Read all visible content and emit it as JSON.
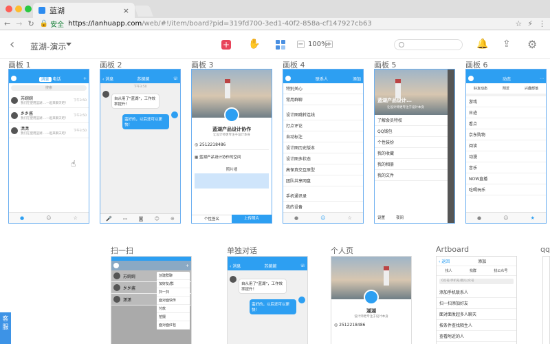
{
  "browser": {
    "tab_title": "蓝湖",
    "tab_close": "×",
    "url_host": "https://lanhuapp.com",
    "url_path": "/web/#!/item/board?pid=319fd700-3ed1-40f2-858a-cf147927cb63",
    "security_label": "安全",
    "traffic_colors": [
      "#fd5f57",
      "#febc2e",
      "#29c840"
    ]
  },
  "header": {
    "back": "‹",
    "project_name": "蓝湖-演示",
    "zoom": "100%",
    "zoom_minus": "−",
    "zoom_plus": "+",
    "add": "+"
  },
  "boards": [
    {
      "label": "画板 1"
    },
    {
      "label": "画板 2"
    },
    {
      "label": "画板 3"
    },
    {
      "label": "画板 4"
    },
    {
      "label": "画板 5"
    },
    {
      "label": "画板 6"
    }
  ],
  "boards_row2": [
    {
      "label": "扫一扫"
    },
    {
      "label": "单独对话"
    },
    {
      "label": "个人页"
    },
    {
      "label": "Artboard"
    },
    {
      "label": "qq"
    }
  ],
  "board1": {
    "tabs": [
      "消息",
      "电话"
    ],
    "search": "搜索",
    "rows": [
      {
        "name": "苏婉婉",
        "sub": "我们在使用蓝湖 ...一起来聊天吧！",
        "time": "下午3:50"
      },
      {
        "name": "乡乡酱",
        "sub": "我们在使用蓝湖 ...一起来聊天吧！",
        "time": "下午3:50"
      },
      {
        "name": "潇潇",
        "sub": "我们在使用蓝湖 ...一起来聊天吧！",
        "time": "下午3:50"
      }
    ]
  },
  "board2": {
    "title": "苏婉婉",
    "back": "‹ 消息",
    "time": "下午3:50",
    "msg_left": "自从用了\"蓝湖\"，工作效率提升！",
    "msg_right": "蛮好的，以后还可以更快！"
  },
  "board3": {
    "name": "蓝湖产品设计协作",
    "tag": "让设计师更专注于设计本身",
    "qq": "2512218486",
    "space": "蓝湖产品设计协作的空间",
    "wall": "照片墙",
    "btn_left": "个性签名",
    "btn_right": "上传照片"
  },
  "board4": {
    "title": "联系人",
    "add": "添加",
    "items": [
      "特别关心",
      "常用群聊",
      "设计图跳转连线",
      "打点评论",
      "自动标注",
      "设计图历史版本",
      "设计图多状态",
      "高保真交互原型",
      "团队共享网盘",
      "手机通讯录",
      "我的设备"
    ]
  },
  "board5": {
    "title": "蓝湖产品设计...",
    "sub": "让设计师更专注于设计本身",
    "items": [
      "了解会员特权",
      "QQ钱包",
      "个性装扮",
      "我的收藏",
      "我的相册",
      "我的文件"
    ],
    "footer_left": "设置",
    "footer_right": "夜间"
  },
  "board6": {
    "title": "动态",
    "top": [
      "好友动态",
      "附近",
      "兴趣部落"
    ],
    "items": [
      "游戏",
      "日迹",
      "看点",
      "京东购物",
      "阅读",
      "动漫",
      "音乐",
      "NOW直播",
      "吃喝玩乐"
    ]
  },
  "scan": {
    "menu": [
      "创建群聊",
      "加好友/群",
      "扫一扫",
      "面对面快传",
      "付款",
      "拍摄",
      "面对面红包"
    ],
    "rows": [
      "苏婉婉",
      "乡乡酱",
      "潇潇"
    ]
  },
  "chat2": {
    "title": "苏婉婉",
    "back": "‹ 消息",
    "msg_left": "自从用了\"蓝湖\"，工作效率提升！",
    "msg_right": "蛮好的，以后还可以更快！"
  },
  "profile": {
    "name": "湖湖",
    "tag": "设计师更专注于设计本身",
    "qq": "2512218486"
  },
  "artboard": {
    "back": "‹ 返回",
    "title": "添加",
    "tabs": [
      "找人",
      "找群",
      "找公众号"
    ],
    "search": "QQ号/手机号/群/公众号",
    "items": [
      "添加手机联系人",
      "扫一扫添加好友",
      "面对面发起多人聊天",
      "按条件查找陌生人",
      "查看附近的人"
    ]
  },
  "side_tab": "客服"
}
